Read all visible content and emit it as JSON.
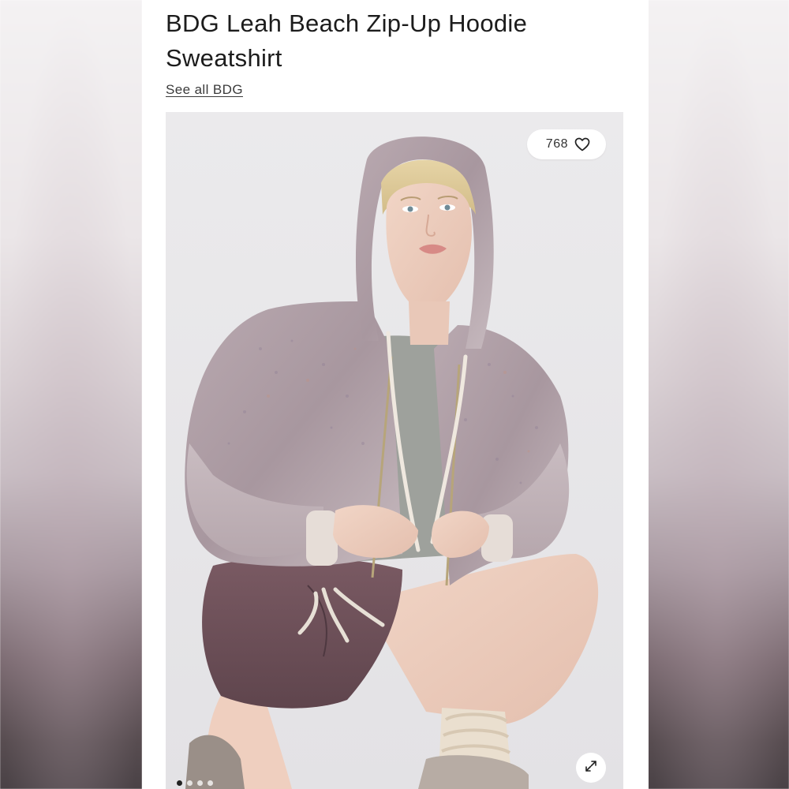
{
  "product": {
    "title": "BDG Leah Beach Zip-Up Hoodie Sweatshirt",
    "brand_link": "See all BDG"
  },
  "gallery": {
    "favorites_count": "768",
    "icons": {
      "favorite": "heart-icon",
      "expand": "expand-icon"
    },
    "carousel": {
      "total_dots": 4,
      "active_index": 0
    }
  },
  "colors": {
    "page_background": "#ffffff",
    "title_text": "#1c1c1c",
    "photo_background": "#e8e7ea",
    "hoodie": "#b3a3aa",
    "shorts": "#6e5059",
    "tank": "#9a9d98"
  }
}
